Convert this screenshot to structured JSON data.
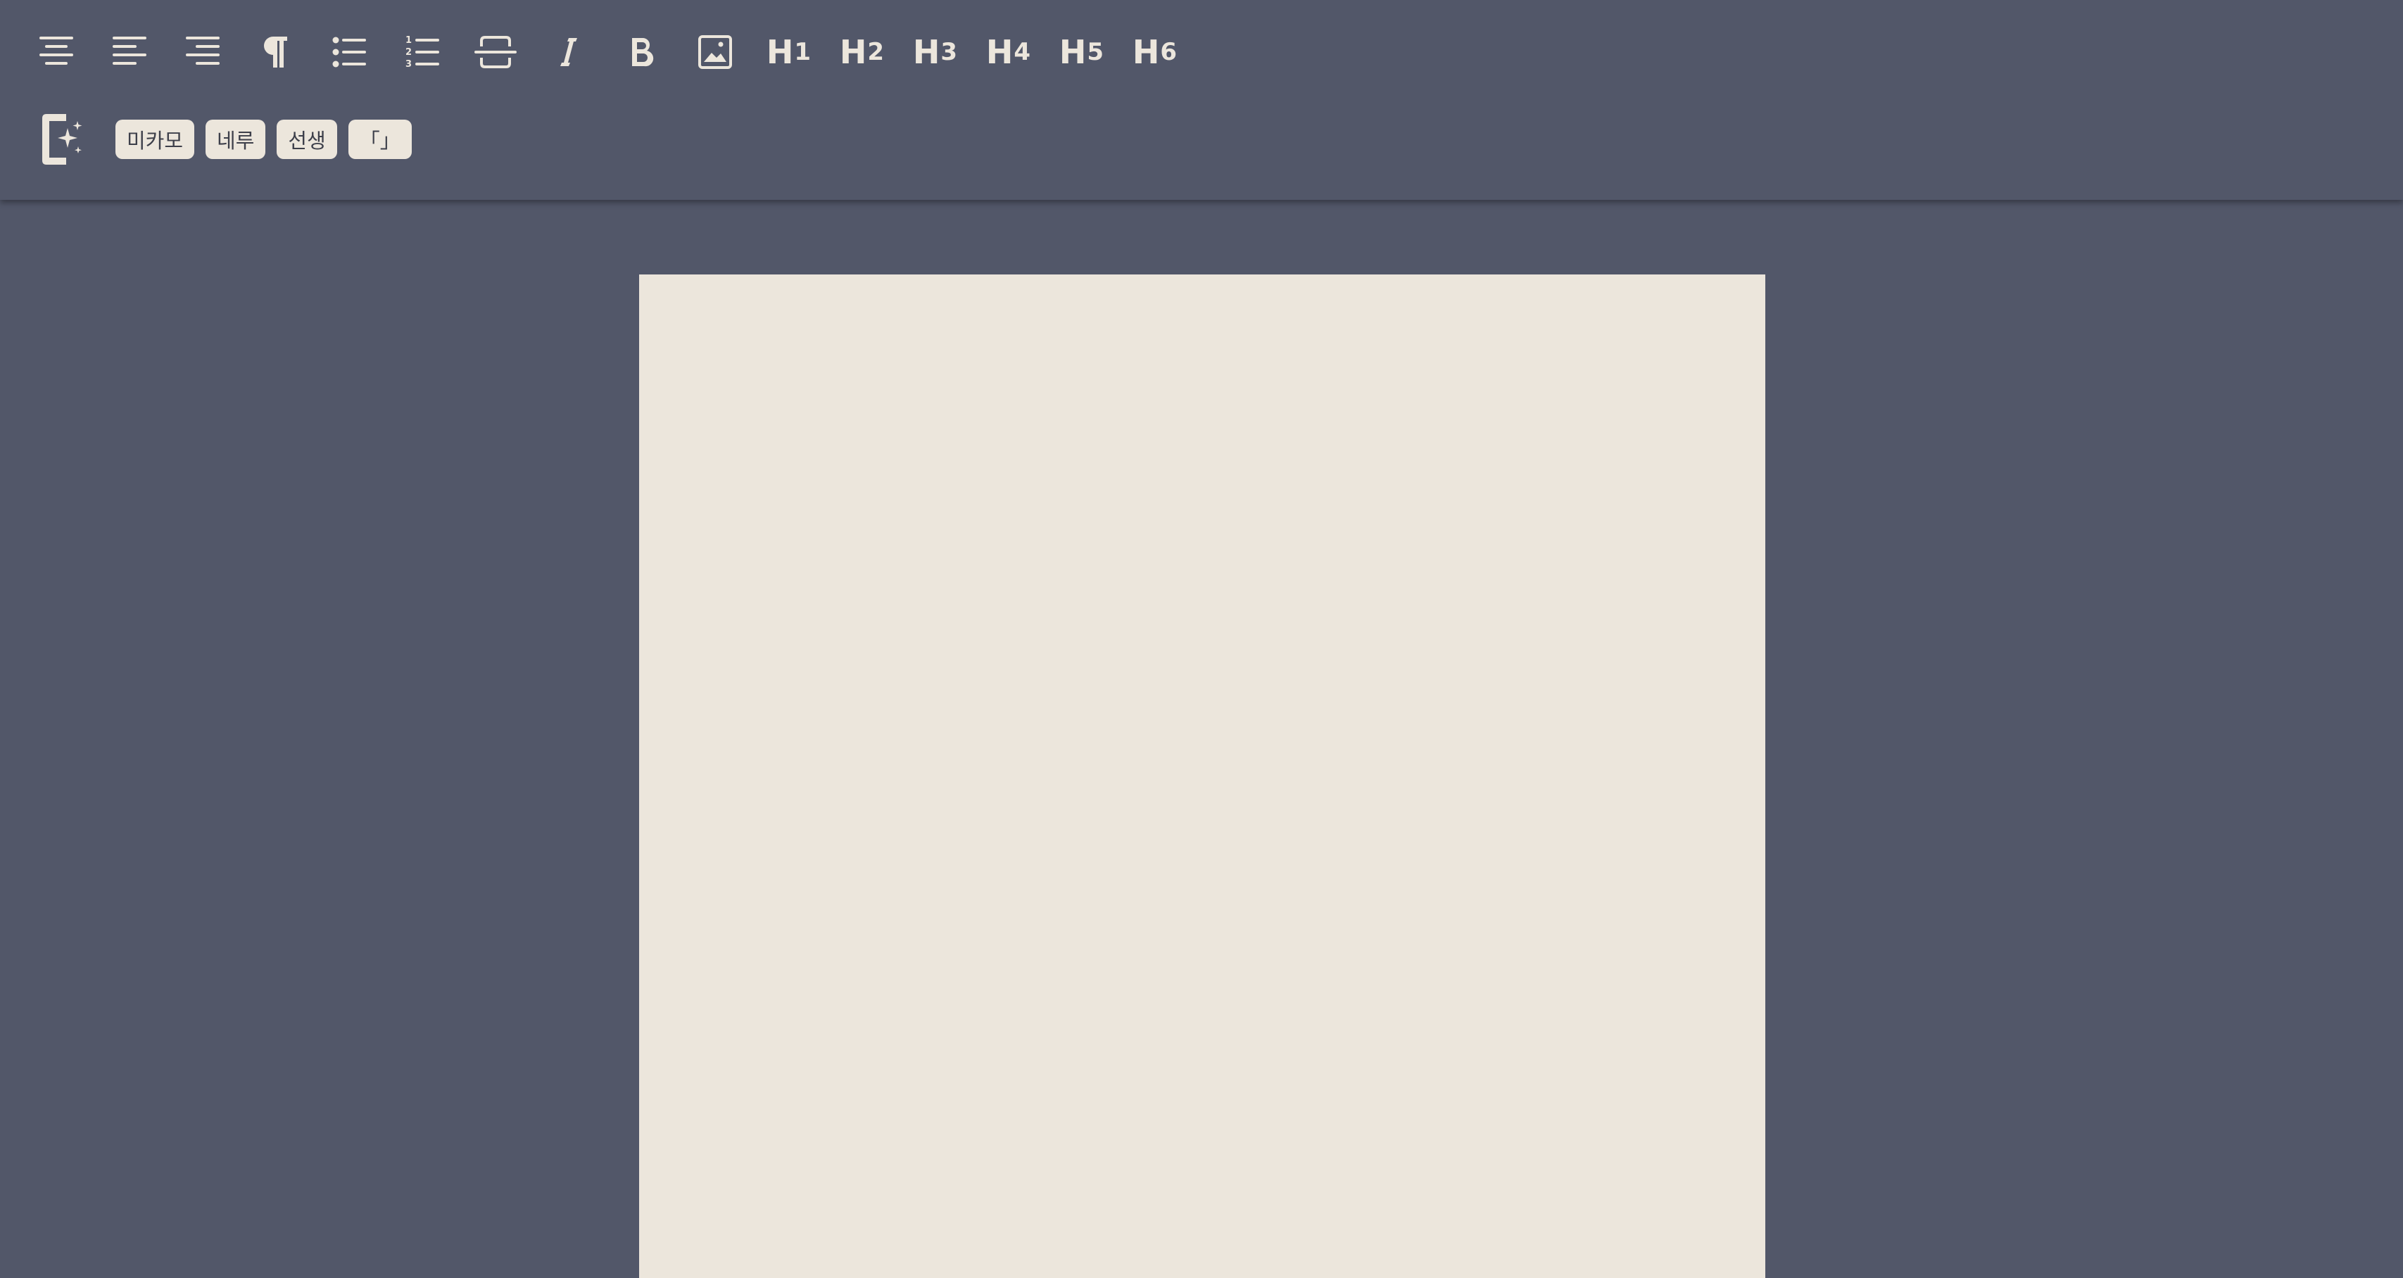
{
  "toolbar": {
    "tools": [
      {
        "name": "align-center",
        "icon": "align-center-icon"
      },
      {
        "name": "align-left",
        "icon": "align-left-icon"
      },
      {
        "name": "align-right",
        "icon": "align-right-icon"
      },
      {
        "name": "paragraph",
        "icon": "pilcrow-icon"
      },
      {
        "name": "bullet-list",
        "icon": "bullet-list-icon"
      },
      {
        "name": "numbered-list",
        "icon": "numbered-list-icon"
      },
      {
        "name": "page-break",
        "icon": "page-break-icon"
      },
      {
        "name": "italic",
        "icon": "italic-icon"
      },
      {
        "name": "bold",
        "icon": "bold-icon"
      },
      {
        "name": "image",
        "icon": "image-icon"
      }
    ],
    "headings": {
      "h1": {
        "letter": "H",
        "level": "1"
      },
      "h2": {
        "letter": "H",
        "level": "2"
      },
      "h3": {
        "letter": "H",
        "level": "3"
      },
      "h4": {
        "letter": "H",
        "level": "4"
      },
      "h5": {
        "letter": "H",
        "level": "5"
      },
      "h6": {
        "letter": "H",
        "level": "6"
      }
    },
    "ai_tool_icon": "document-sparkle-icon",
    "chips": {
      "mikamo": "미카모",
      "neru": "네루",
      "teacher": "선생",
      "bracket": "「」"
    }
  },
  "colors": {
    "background": "#525769",
    "icon": "#ece6dc",
    "page": "#ece6dc",
    "chip_text": "#3d3f4a"
  }
}
